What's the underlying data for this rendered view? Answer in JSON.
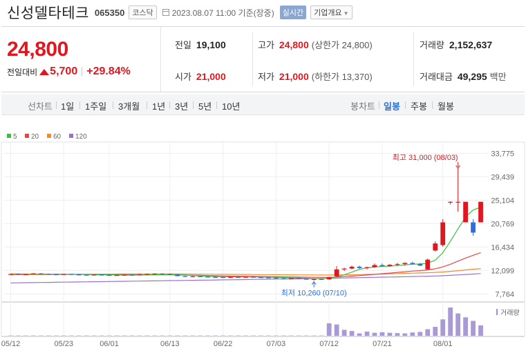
{
  "header": {
    "company": "신성델타테크",
    "code": "065350",
    "market": "코스닥",
    "datetime": "2023.08.07 11:00 기준(장중)",
    "realtime_label": "실시간",
    "company_info_label": "기업개요"
  },
  "price": {
    "current": "24,800",
    "change_label": "전일대비",
    "change": "5,700",
    "rate": "+29.84%"
  },
  "stats": {
    "prev_label": "전일",
    "prev": "19,100",
    "open_label": "시가",
    "open": "21,000",
    "high_label": "고가",
    "high": "24,800",
    "upper_limit": "(상한가 24,800)",
    "low_label": "저가",
    "low": "21,000",
    "lower_limit": "(하한가 13,370)",
    "volume_label": "거래량",
    "volume": "2,152,637",
    "amount_label": "거래대금",
    "amount": "49,295",
    "amount_unit": "백만"
  },
  "periods": {
    "line_label": "선차트",
    "line_items": [
      "1일",
      "1주일",
      "3개월",
      "1년",
      "3년",
      "5년",
      "10년"
    ],
    "candle_label": "봉차트",
    "candle_items": [
      "일봉",
      "주봉",
      "월봉"
    ],
    "candle_active": "일봉"
  },
  "colors": {
    "up": "#e0171e",
    "down": "#2c6fd6",
    "accent": "#2c6fd6"
  },
  "chart_data": {
    "type": "candlestick",
    "legend": [
      {
        "name": "5",
        "color": "#3dbf3d"
      },
      {
        "name": "20",
        "color": "#e64545"
      },
      {
        "name": "60",
        "color": "#f08a2e"
      },
      {
        "name": "120",
        "color": "#9b6fd0"
      }
    ],
    "y_ticks": [
      "33,775",
      "29,439",
      "25,104",
      "20,769",
      "16,434",
      "12,099",
      "7,764"
    ],
    "y_tick_values": [
      33775,
      29439,
      25104,
      20769,
      16434,
      12099,
      7764
    ],
    "ylim": [
      6400,
      35600
    ],
    "x_ticks": [
      "05/12",
      "05/23",
      "06/01",
      "06/13",
      "06/22",
      "07/03",
      "07/12",
      "07/21",
      "08/01"
    ],
    "x_tick_index": [
      0,
      7,
      13,
      21,
      28,
      35,
      42,
      49,
      57
    ],
    "annotations": {
      "high": "최고 31,000 (08/03)",
      "low": "최저 10,260 (07/10)"
    },
    "high_index": 59,
    "low_index": 40,
    "volume_label": "거래량",
    "candles": [
      [
        11400,
        11520,
        11300,
        11450
      ],
      [
        11450,
        11550,
        11350,
        11380
      ],
      [
        11380,
        11480,
        11250,
        11420
      ],
      [
        11420,
        11600,
        11380,
        11560
      ],
      [
        11560,
        11620,
        11400,
        11450
      ],
      [
        11450,
        11520,
        11350,
        11400
      ],
      [
        11400,
        11460,
        11300,
        11380
      ],
      [
        11380,
        11480,
        11300,
        11440
      ],
      [
        11440,
        11500,
        11320,
        11350
      ],
      [
        11350,
        11420,
        11250,
        11300
      ],
      [
        11300,
        11380,
        11200,
        11280
      ],
      [
        11280,
        11360,
        11180,
        11320
      ],
      [
        11320,
        11400,
        11220,
        11260
      ],
      [
        11260,
        11320,
        11150,
        11200
      ],
      [
        11200,
        11300,
        11120,
        11250
      ],
      [
        11250,
        11350,
        11180,
        11300
      ],
      [
        11300,
        11380,
        11200,
        11260
      ],
      [
        11260,
        11420,
        11220,
        11400
      ],
      [
        11400,
        11500,
        11320,
        11450
      ],
      [
        11450,
        11560,
        11380,
        11520
      ],
      [
        11520,
        11600,
        11400,
        11480
      ],
      [
        11480,
        11540,
        11300,
        11350
      ],
      [
        11350,
        11420,
        11100,
        11050
      ],
      [
        11050,
        11150,
        10900,
        10980
      ],
      [
        10980,
        11080,
        10850,
        11020
      ],
      [
        11020,
        11100,
        10900,
        10950
      ],
      [
        10950,
        11050,
        10850,
        10900
      ],
      [
        10900,
        11000,
        10800,
        10880
      ],
      [
        10880,
        10960,
        10750,
        10800
      ],
      [
        10800,
        10950,
        10700,
        10900
      ],
      [
        10900,
        11000,
        10800,
        10860
      ],
      [
        10860,
        10960,
        10780,
        10920
      ],
      [
        10920,
        11000,
        10820,
        10850
      ],
      [
        10850,
        10940,
        10760,
        10800
      ],
      [
        10800,
        10880,
        10700,
        10750
      ],
      [
        10750,
        10820,
        10600,
        10650
      ],
      [
        10650,
        10740,
        10540,
        10600
      ],
      [
        10600,
        10700,
        10500,
        10680
      ],
      [
        10680,
        10760,
        10520,
        10560
      ],
      [
        10560,
        10640,
        10400,
        10480
      ],
      [
        10480,
        10580,
        10260,
        10500
      ],
      [
        10500,
        10600,
        10380,
        10450
      ],
      [
        10450,
        10900,
        10400,
        10850
      ],
      [
        11000,
        12900,
        10900,
        12300
      ],
      [
        12300,
        12600,
        12000,
        12450
      ],
      [
        12450,
        13000,
        12300,
        12800
      ],
      [
        12800,
        13000,
        12400,
        12550
      ],
      [
        12550,
        12800,
        12300,
        12700
      ],
      [
        12700,
        13400,
        12600,
        13100
      ],
      [
        13100,
        13400,
        12800,
        12900
      ],
      [
        12900,
        13300,
        12800,
        13150
      ],
      [
        13150,
        13500,
        12900,
        13300
      ],
      [
        13300,
        13600,
        13000,
        13500
      ],
      [
        13500,
        13700,
        13200,
        13300
      ],
      [
        13300,
        13500,
        12900,
        13000
      ],
      [
        12300,
        14300,
        12200,
        14100
      ],
      [
        15800,
        17500,
        15600,
        17100
      ],
      [
        16800,
        21600,
        16500,
        21000
      ],
      [
        24800,
        24900,
        24300,
        24800
      ],
      [
        24800,
        31000,
        23000,
        24800
      ],
      [
        21000,
        24800,
        21000,
        24800
      ],
      [
        21000,
        21600,
        18500,
        19100
      ],
      [
        21000,
        24800,
        21000,
        24800
      ]
    ],
    "volumes": [
      1,
      1,
      1,
      1,
      1,
      1,
      1,
      1,
      1,
      1,
      1,
      1,
      1,
      1,
      1,
      1,
      1,
      1,
      1,
      1,
      1,
      1,
      1,
      1,
      1,
      1,
      1,
      1,
      1,
      1,
      1,
      1,
      1,
      1,
      1,
      1,
      1,
      1,
      1,
      1,
      1,
      1,
      42,
      38,
      20,
      16,
      8,
      14,
      10,
      12,
      10,
      9,
      8,
      11,
      13,
      22,
      30,
      55,
      95,
      75,
      62,
      50,
      35
    ],
    "ma5": [
      11400,
      11420,
      11410,
      11430,
      11440,
      11430,
      11420,
      11410,
      11400,
      11380,
      11360,
      11330,
      11300,
      11280,
      11260,
      11250,
      11250,
      11260,
      11280,
      11310,
      11340,
      11350,
      11320,
      11260,
      11180,
      11100,
      11030,
      10980,
      10950,
      10930,
      10920,
      10910,
      10900,
      10880,
      10860,
      10830,
      10790,
      10740,
      10700,
      10660,
      10610,
      10580,
      10650,
      10900,
      11300,
      11800,
      12300,
      12600,
      12750,
      12850,
      12900,
      13000,
      13150,
      13250,
      13300,
      13450,
      14000,
      15400,
      17500,
      19800,
      22000,
      23300,
      23800
    ],
    "ma20": [
      11450,
      11450,
      11440,
      11440,
      11430,
      11420,
      11410,
      11400,
      11390,
      11380,
      11370,
      11360,
      11350,
      11340,
      11330,
      11320,
      11310,
      11300,
      11300,
      11300,
      11300,
      11290,
      11270,
      11240,
      11210,
      11180,
      11150,
      11120,
      11090,
      11060,
      11040,
      11020,
      11000,
      10980,
      10960,
      10940,
      10920,
      10900,
      10880,
      10860,
      10840,
      10820,
      10830,
      10880,
      10960,
      11050,
      11150,
      11260,
      11380,
      11500,
      11620,
      11740,
      11860,
      11980,
      12080,
      12200,
      12420,
      12760,
      13250,
      13830,
      14400,
      14900,
      15400
    ],
    "ma60": [
      11300,
      11310,
      11320,
      11330,
      11340,
      11350,
      11360,
      11370,
      11380,
      11390,
      11400,
      11410,
      11420,
      11430,
      11440,
      11450,
      11450,
      11460,
      11460,
      11460,
      11460,
      11460,
      11450,
      11440,
      11430,
      11420,
      11410,
      11400,
      11390,
      11380,
      11370,
      11360,
      11350,
      11340,
      11330,
      11320,
      11310,
      11300,
      11290,
      11280,
      11270,
      11260,
      11260,
      11270,
      11290,
      11310,
      11340,
      11370,
      11400,
      11440,
      11480,
      11520,
      11560,
      11600,
      11640,
      11680,
      11740,
      11820,
      11930,
      12060,
      12200,
      12330,
      12450
    ],
    "ma120": [
      9800,
      9820,
      9840,
      9860,
      9880,
      9900,
      9920,
      9940,
      9960,
      9980,
      10000,
      10020,
      10040,
      10060,
      10080,
      10100,
      10120,
      10140,
      10160,
      10180,
      10200,
      10220,
      10240,
      10260,
      10280,
      10300,
      10320,
      10340,
      10360,
      10380,
      10400,
      10420,
      10440,
      10460,
      10480,
      10500,
      10520,
      10540,
      10560,
      10580,
      10600,
      10620,
      10650,
      10680,
      10710,
      10740,
      10770,
      10800,
      10830,
      10860,
      10890,
      10920,
      10950,
      10980,
      11010,
      11040,
      11080,
      11130,
      11200,
      11280,
      11360,
      11440,
      11520
    ]
  }
}
